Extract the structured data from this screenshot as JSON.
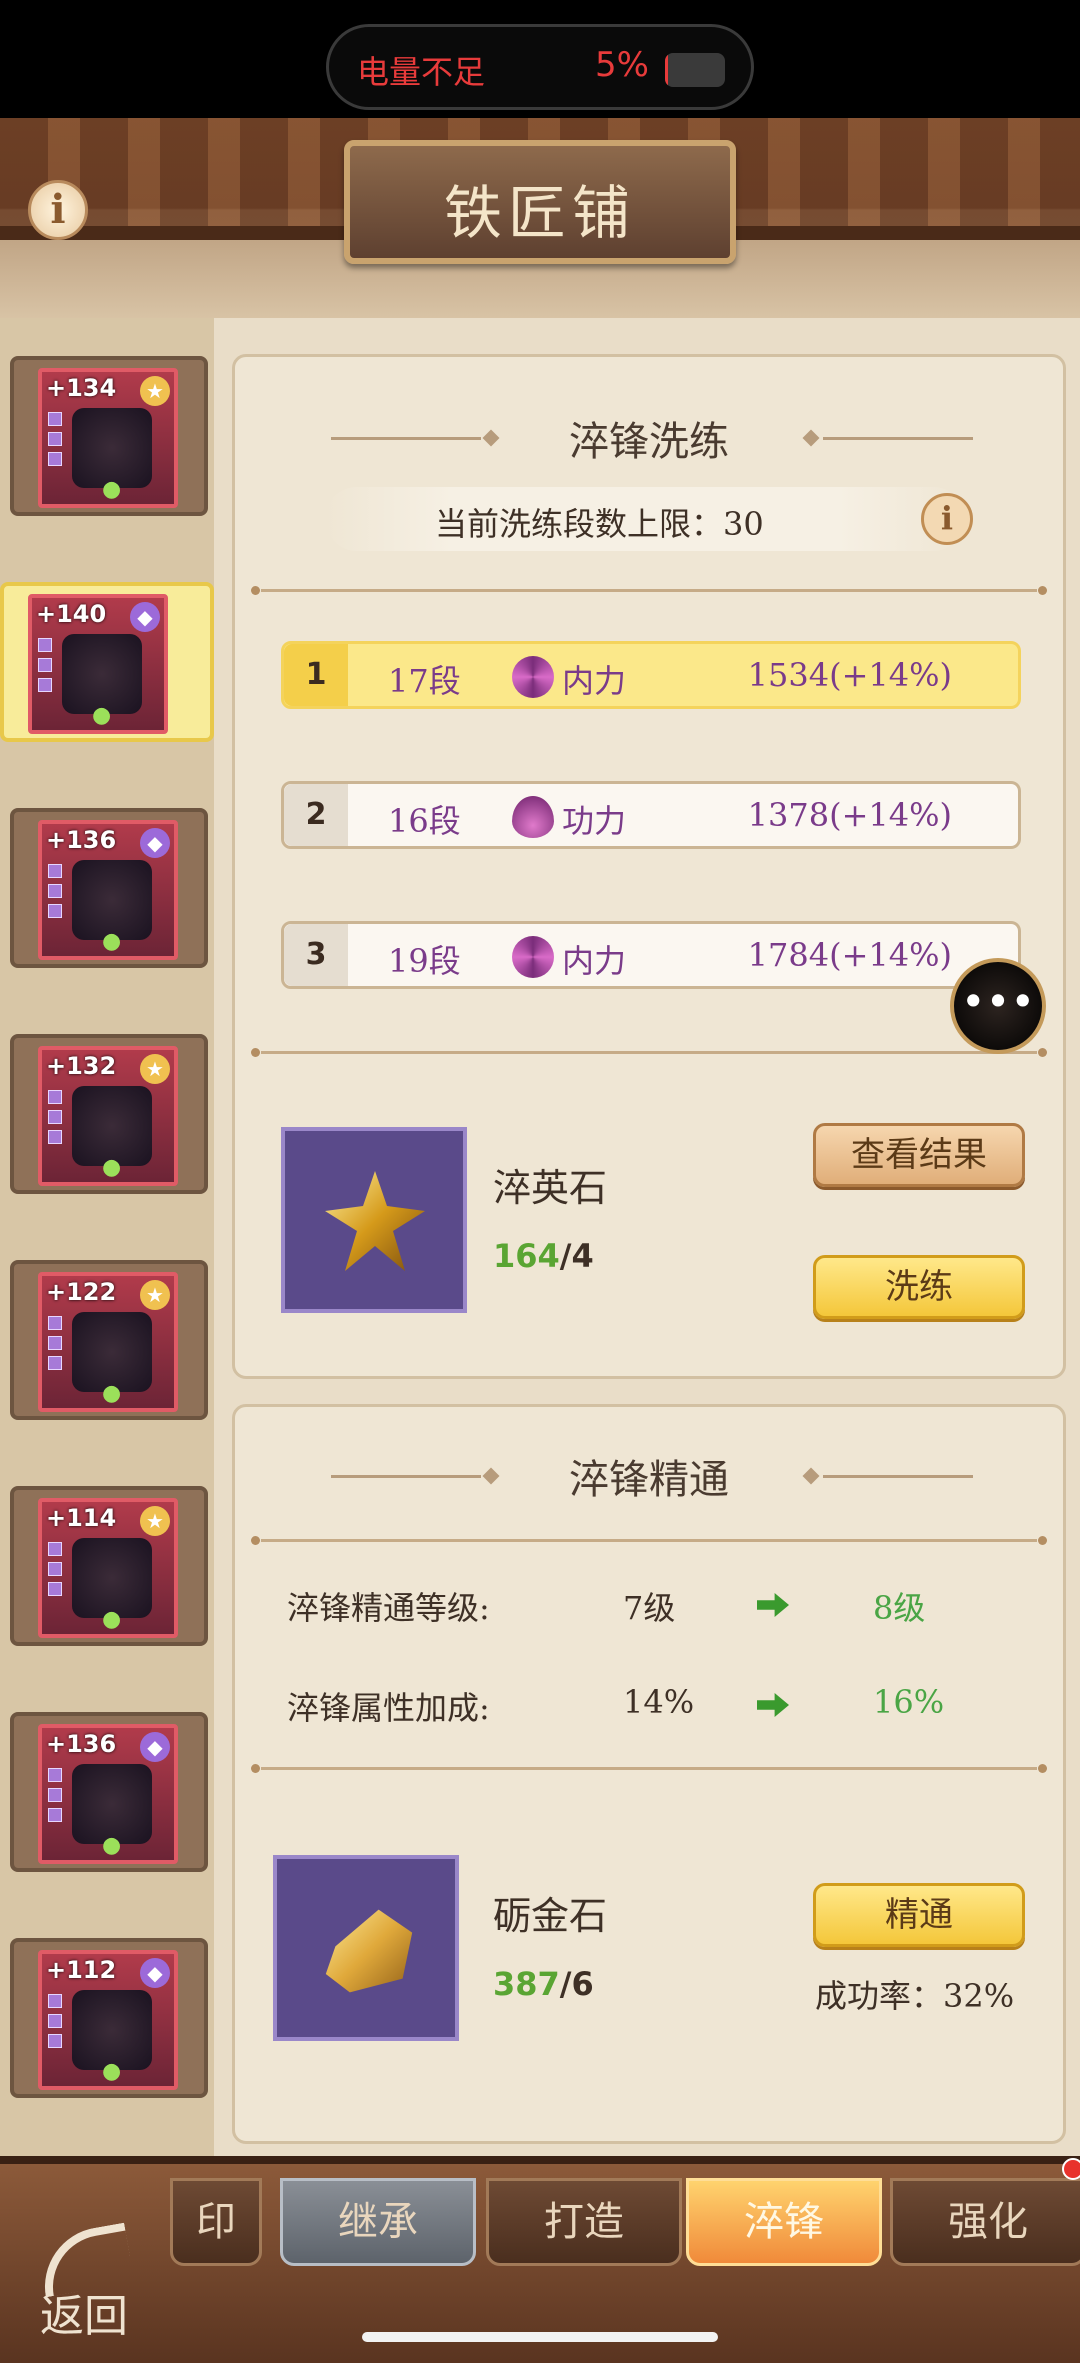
{
  "status": {
    "battery_warning": "电量不足",
    "battery_percent": "5%",
    "battery_level": 0.05,
    "color_warning": "#e83b3b"
  },
  "header": {
    "title": "铁匠铺",
    "info_icon": "info-icon"
  },
  "sidebar": {
    "items": [
      {
        "level": "+134",
        "badge": "star",
        "selected": false
      },
      {
        "level": "+140",
        "badge": "diamond",
        "selected": true
      },
      {
        "level": "+136",
        "badge": "diamond",
        "selected": false
      },
      {
        "level": "+132",
        "badge": "star",
        "selected": false
      },
      {
        "level": "+122",
        "badge": "star",
        "selected": false
      },
      {
        "level": "+114",
        "badge": "star",
        "selected": false
      },
      {
        "level": "+136",
        "badge": "diamond",
        "selected": false
      },
      {
        "level": "+112",
        "badge": "diamond",
        "selected": false
      }
    ]
  },
  "refine": {
    "title": "淬锋洗练",
    "limit_text": "当前洗练段数上限：30",
    "rows": [
      {
        "index": "1",
        "segment": "17段",
        "icon": "swirl-icon",
        "stat": "内力",
        "value": "1534(+14%)",
        "active": true
      },
      {
        "index": "2",
        "segment": "16段",
        "icon": "flame-icon",
        "stat": "功力",
        "value": "1378(+14%)",
        "active": false
      },
      {
        "index": "3",
        "segment": "19段",
        "icon": "swirl-icon",
        "stat": "内力",
        "value": "1784(+14%)",
        "active": false
      }
    ],
    "material_name": "淬英石",
    "material_have": "164",
    "material_need": "/4",
    "view_result_label": "查看结果",
    "refine_label": "洗练"
  },
  "mastery": {
    "title": "淬锋精通",
    "level_label": "淬锋精通等级:",
    "level_current": "7级",
    "level_next": "8级",
    "bonus_label": "淬锋属性加成:",
    "bonus_current": "14%",
    "bonus_next": "16%",
    "material_name": "砺金石",
    "material_have": "387",
    "material_need": "/6",
    "master_label": "精通",
    "success_rate": "成功率：32%"
  },
  "tabs": [
    {
      "label": "印",
      "state": "partial"
    },
    {
      "label": "继承",
      "state": "gray"
    },
    {
      "label": "打造",
      "state": "normal"
    },
    {
      "label": "淬锋",
      "state": "active"
    },
    {
      "label": "强化",
      "state": "normal"
    }
  ],
  "footer": {
    "back_label": "返回"
  },
  "chat_icon": "chat-bubble-icon"
}
